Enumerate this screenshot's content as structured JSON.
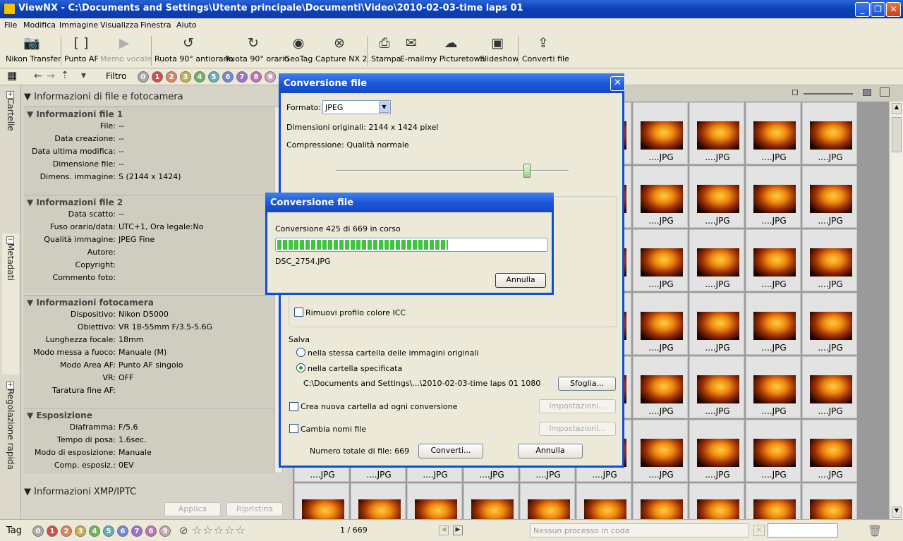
{
  "window": {
    "title": "ViewNX - C:\\Documents and Settings\\Utente principale\\Documenti\\Video\\2010-02-03-time laps 01",
    "minimize": "_",
    "maximize": "❐",
    "close": "✕"
  },
  "menu": [
    "File",
    "Modifica",
    "Immagine",
    "Visualizza",
    "Finestra",
    "Aiuto"
  ],
  "toolbar": [
    {
      "label": "Nikon Transfer",
      "icon": "camera-transfer-icon"
    },
    {
      "label": "Punto AF",
      "icon": "af-point-icon"
    },
    {
      "label": "Memo vocale",
      "icon": "voice-memo-icon",
      "disabled": true
    },
    {
      "label": "Ruota 90° antiorario",
      "icon": "rotate-ccw-icon"
    },
    {
      "label": "Ruota 90° orario",
      "icon": "rotate-cw-icon"
    },
    {
      "label": "GeoTag",
      "icon": "geotag-icon"
    },
    {
      "label": "Capture NX 2",
      "icon": "capture-nx-icon"
    },
    {
      "label": "Stampa",
      "icon": "print-icon"
    },
    {
      "label": "E-mail",
      "icon": "email-icon"
    },
    {
      "label": "my Picturetown",
      "icon": "picturetown-icon"
    },
    {
      "label": "Slideshow",
      "icon": "slideshow-icon"
    },
    {
      "label": "Converti file",
      "icon": "convert-file-icon"
    }
  ],
  "filter": {
    "label": "Filtro",
    "labels": [
      "0",
      "1",
      "2",
      "3",
      "4",
      "5",
      "6",
      "7",
      "8",
      "9"
    ]
  },
  "label_colors": [
    "#a9a9a9",
    "#d34b4b",
    "#d9865b",
    "#c6b04a",
    "#6fb25f",
    "#5fb0b8",
    "#6f88d8",
    "#9d6fd0",
    "#c26fb8",
    "#c8a8b8"
  ],
  "sidetabs": {
    "folders": "Cartelle",
    "metadata": "Metadati",
    "quick_adjust": "Regolazione rapida"
  },
  "info": {
    "header": "Informazioni di file e fotocamera",
    "file1": {
      "title": "Informazioni file 1",
      "rows": [
        {
          "k": "File:",
          "v": "--"
        },
        {
          "k": "Data creazione:",
          "v": "--"
        },
        {
          "k": "Data ultima modifica:",
          "v": "--"
        },
        {
          "k": "Dimensione file:",
          "v": "--"
        },
        {
          "k": "Dimens. immagine:",
          "v": "S (2144 x 1424)"
        }
      ]
    },
    "file2": {
      "title": "Informazioni file 2",
      "rows": [
        {
          "k": "Data scatto:",
          "v": "--"
        },
        {
          "k": "Fuso orario/data:",
          "v": "UTC+1, Ora legale:No"
        },
        {
          "k": "Qualità immagine:",
          "v": "JPEG Fine"
        },
        {
          "k": "Autore:",
          "v": ""
        },
        {
          "k": "Copyright:",
          "v": ""
        },
        {
          "k": "Commento foto:",
          "v": ""
        }
      ]
    },
    "camera": {
      "title": "Informazioni fotocamera",
      "rows": [
        {
          "k": "Dispositivo:",
          "v": "Nikon D5000"
        },
        {
          "k": "Obiettivo:",
          "v": "VR 18-55mm F/3.5-5.6G"
        },
        {
          "k": "Lunghezza focale:",
          "v": "18mm"
        },
        {
          "k": "Modo messa a fuoco:",
          "v": "Manuale (M)"
        },
        {
          "k": "Modo Area AF:",
          "v": "Punto AF singolo"
        },
        {
          "k": "VR:",
          "v": "OFF"
        },
        {
          "k": "Taratura fine AF:",
          "v": ""
        }
      ]
    },
    "exposure": {
      "title": "Esposizione",
      "rows": [
        {
          "k": "Diaframma:",
          "v": "F/5.6"
        },
        {
          "k": "Tempo di posa:",
          "v": "1.6sec."
        },
        {
          "k": "Modo di esposizione:",
          "v": "Manuale"
        },
        {
          "k": "Comp. esposiz.:",
          "v": "0EV"
        }
      ]
    },
    "xmp": "Informazioni XMP/IPTC",
    "apply": "Applica",
    "reset": "Ripristina"
  },
  "thumb_label": "....JPG",
  "status": {
    "tag": "Tag",
    "labels": [
      "0",
      "1",
      "2",
      "3",
      "4",
      "5",
      "6",
      "7",
      "8",
      "9"
    ],
    "count": "1 / 669",
    "queue": "Nessun processo in coda"
  },
  "convert_dialog": {
    "title": "Conversione file",
    "format_label": "Formato:",
    "format_value": "JPEG",
    "dims": "Dimensioni originali: 2144 x 1424 pixel",
    "compression": "Compressione: Qualità normale",
    "compression_level": 0.82,
    "remove_icc": "Rimuovi profilo colore ICC",
    "save": "Salva",
    "save_same": "nella stessa cartella delle immagini originali",
    "save_specified": "nella cartella specificata",
    "path": "C:\\Documents and Settings\\...\\2010-02-03-time laps 01 1080",
    "browse": "Sfoglia...",
    "new_folder": "Crea nuova cartella ad ogni conversione",
    "settings": "Impostazioni...",
    "rename": "Cambia nomi file",
    "total": "Numero totale di file: 669",
    "convert": "Converti...",
    "cancel": "Annulla"
  },
  "progress_dialog": {
    "title": "Conversione file",
    "status": "Conversione 425 di 669 in corso",
    "progress": 0.635,
    "file": "DSC_2754.JPG",
    "cancel": "Annulla"
  }
}
